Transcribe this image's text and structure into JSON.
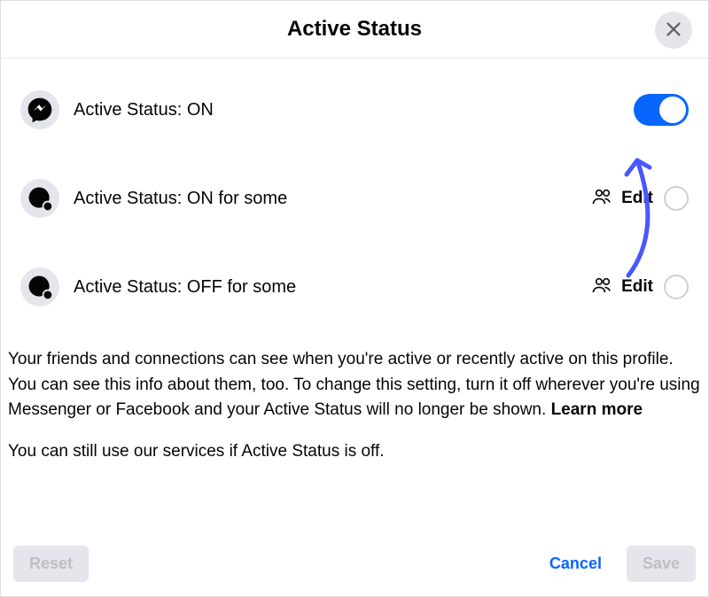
{
  "header": {
    "title": "Active Status"
  },
  "options": [
    {
      "label": "Active Status: ON"
    },
    {
      "label": "Active Status: ON for some",
      "edit": "Edit"
    },
    {
      "label": "Active Status: OFF for some",
      "edit": "Edit"
    }
  ],
  "description": {
    "para1_prefix": "Your friends and connections can see when you're active or recently active on this profile. You can see this info about them, too. To change this setting, turn it off wherever you're using Messenger or Facebook and your Active Status will no longer be shown. ",
    "learn_more": "Learn more",
    "para2": "You can still use our services if Active Status is off."
  },
  "footer": {
    "reset": "Reset",
    "cancel": "Cancel",
    "save": "Save"
  }
}
